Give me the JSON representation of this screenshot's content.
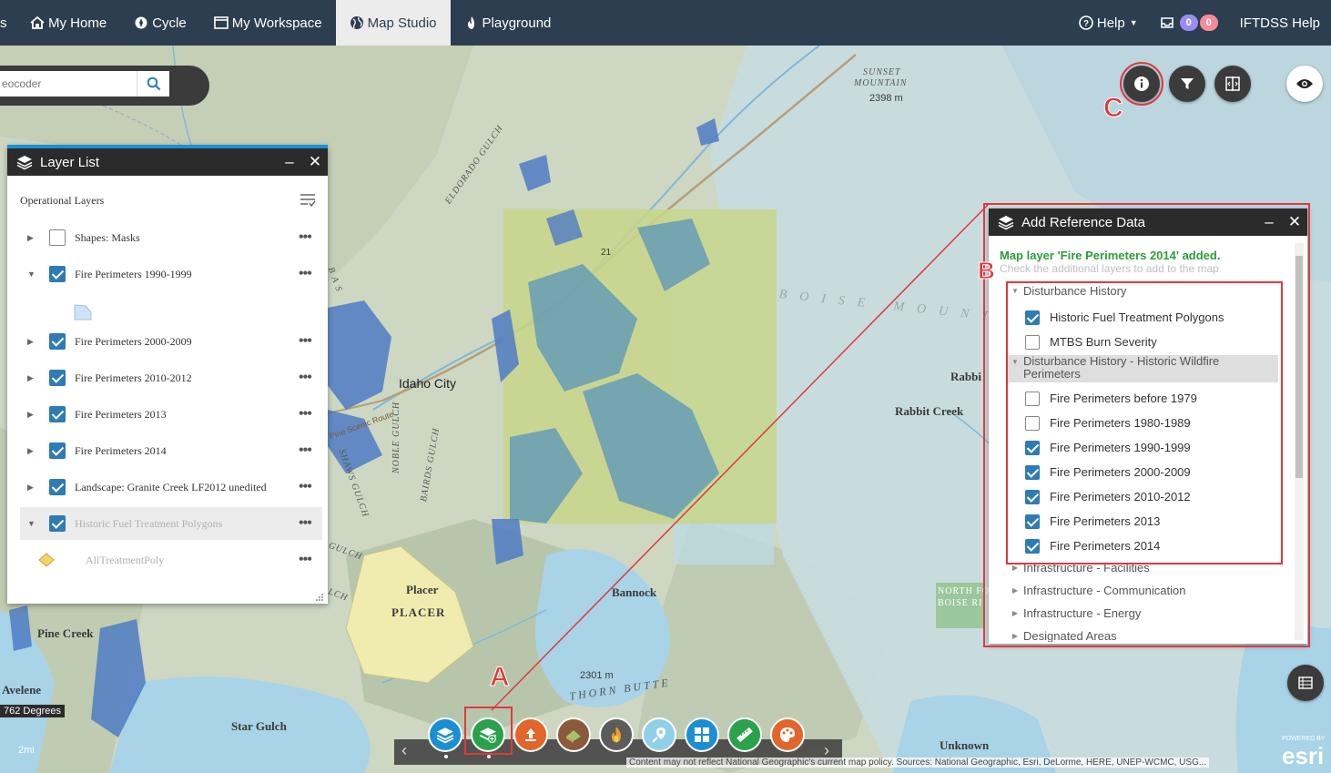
{
  "nav": {
    "items": [
      {
        "label": "My Home",
        "icon": "home-icon"
      },
      {
        "label": "Cycle",
        "icon": "cycle-icon"
      },
      {
        "label": "My Workspace",
        "icon": "workspace-icon"
      },
      {
        "label": "Map Studio",
        "icon": "globe-icon",
        "active": true
      },
      {
        "label": "Playground",
        "icon": "flame-icon"
      }
    ],
    "help_label": "Help",
    "badge_purple": "0",
    "badge_pink": "0",
    "user_label": "IFTDSS Help",
    "truncated_left": "s"
  },
  "search": {
    "placeholder": "eocoder"
  },
  "layer_list": {
    "title": "Layer List",
    "section": "Operational Layers",
    "rows": [
      {
        "label": "Shapes: Masks",
        "checked": false,
        "expanded": false
      },
      {
        "label": "Fire Perimeters 1990-1999",
        "checked": true,
        "expanded": true
      },
      {
        "label": "Fire Perimeters 2000-2009",
        "checked": true,
        "expanded": false
      },
      {
        "label": "Fire Perimeters 2010-2012",
        "checked": true,
        "expanded": false
      },
      {
        "label": "Fire Perimeters 2013",
        "checked": true,
        "expanded": false
      },
      {
        "label": "Fire Perimeters 2014",
        "checked": true,
        "expanded": false
      },
      {
        "label": "Landscape: Granite Creek LF2012 unedited",
        "checked": true,
        "expanded": false
      },
      {
        "label": "Historic Fuel Treatment Polygons",
        "checked": true,
        "expanded": true
      }
    ],
    "sublayer": "AllTreatmentPoly",
    "more": "•••"
  },
  "add_ref": {
    "title": "Add Reference Data",
    "success": "Map layer 'Fire Perimeters 2014' added.",
    "hint": "Check the additional layers to add to the map",
    "group1": "Disturbance History",
    "group1_items": [
      {
        "label": "Historic Fuel Treatment Polygons",
        "checked": true
      },
      {
        "label": "MTBS Burn Severity",
        "checked": false
      }
    ],
    "group2": "Disturbance History - Historic Wildfire Perimeters",
    "group2_items": [
      {
        "label": "Fire Perimeters before 1979",
        "checked": false
      },
      {
        "label": "Fire Perimeters 1980-1989",
        "checked": false
      },
      {
        "label": "Fire Perimeters 1990-1999",
        "checked": true
      },
      {
        "label": "Fire Perimeters 2000-2009",
        "checked": true
      },
      {
        "label": "Fire Perimeters 2010-2012",
        "checked": true
      },
      {
        "label": "Fire Perimeters 2013",
        "checked": true
      },
      {
        "label": "Fire Perimeters 2014",
        "checked": true
      }
    ],
    "collapsed_groups": [
      "Infrastructure - Facilities",
      "Infrastructure - Communication",
      "Infrastructure - Energy",
      "Designated Areas"
    ]
  },
  "callouts": {
    "a": "A",
    "b": "B",
    "c": "C"
  },
  "map_labels": {
    "sunset": "SUNSET",
    "mountain": "MOUNTAIN",
    "sunset_elev": "2398 m",
    "idaho_city": "Idaho City",
    "rabbit_creek": "Rabbit Creek",
    "rabbit_trunc": "Rabbi",
    "bannock": "Bannock",
    "placer": "Placer",
    "placer_caps": "PLACER",
    "pine_creek": "Pine Creek",
    "avelene": "Avelene",
    "star_gulch": "Star Gulch",
    "unknown": "Unknown",
    "thorn_butte": "THORN BUTTE",
    "thorn_elev": "2301 m",
    "boise_mtns": "BOISE MOUNTA",
    "eldorado": "ELDORADO GULCH",
    "noble": "NOBLE GULCH",
    "bairds": "BAIRDS GULCH",
    "shaws": "SHAWS GULCH",
    "route": "21",
    "north_fork_1": "NORTH FO",
    "north_fork_2": "BOISE RI",
    "gulch": "GULCH",
    "lch": "LCH",
    "bas": "BAS",
    "pine_trail": "Pine Scenic Route",
    "dist_label": "2mi"
  },
  "scale_text": "762 Degrees",
  "attribution": "Content may not reflect National Geographic's current map policy. Sources: National Geographic, Esri, DeLorme, HERE, UNEP-WCMC, USG...",
  "esri": {
    "powered": "POWERED BY",
    "brand": "esri"
  },
  "toolbar": {
    "buttons": [
      {
        "name": "layer-list-tool",
        "color": "#1c8fd4"
      },
      {
        "name": "add-reference-data-tool",
        "color": "#2aa14a"
      },
      {
        "name": "upload-tool",
        "color": "#e2662b"
      },
      {
        "name": "landscape-tool",
        "color": "#8b5a3c"
      },
      {
        "name": "fire-tool",
        "color": "#5c5c5c"
      },
      {
        "name": "location-tool",
        "color": "#8fd0e8"
      },
      {
        "name": "grid-tool",
        "color": "#1c8fd4"
      },
      {
        "name": "measure-tool",
        "color": "#2aa14a"
      },
      {
        "name": "symbology-tool",
        "color": "#e2662b"
      }
    ]
  }
}
